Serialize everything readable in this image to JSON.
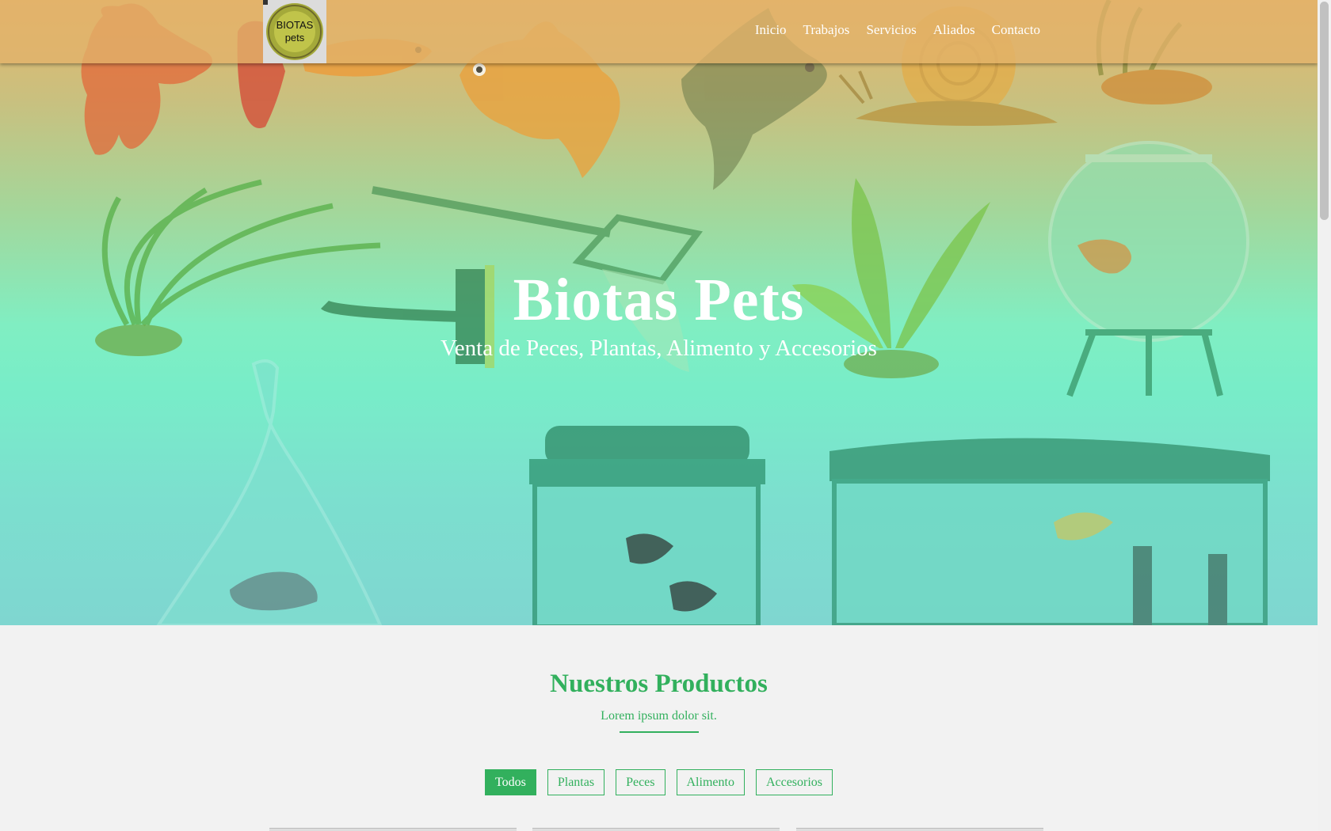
{
  "navbar": {
    "logo_text_top": "BIOTAS",
    "logo_text_bottom": "pets",
    "links": [
      "Inicio",
      "Trabajos",
      "Servicios",
      "Aliados",
      "Contacto"
    ]
  },
  "hero": {
    "title": "Biotas Pets",
    "subtitle": "Venta de Peces, Plantas, Alimento y Accesorios"
  },
  "products": {
    "title": "Nuestros Productos",
    "subtitle": "Lorem ipsum dolor sit.",
    "filters": [
      {
        "label": "Todos",
        "active": true
      },
      {
        "label": "Plantas",
        "active": false
      },
      {
        "label": "Peces",
        "active": false
      },
      {
        "label": "Alimento",
        "active": false
      },
      {
        "label": "Accesorios",
        "active": false
      }
    ]
  },
  "colors": {
    "accent": "#32b05d",
    "navbar": "#e2b26a",
    "hero_top": "#e7b66b",
    "hero_mid": "#78edc8",
    "page_bg": "#f2f2f2"
  }
}
